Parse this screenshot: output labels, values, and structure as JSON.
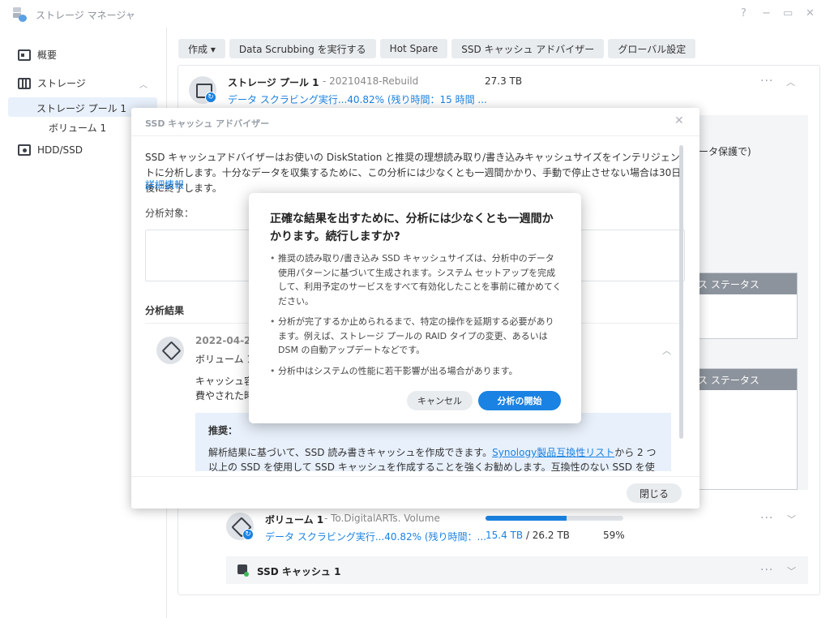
{
  "window": {
    "title": "ストレージ マネージャ",
    "controls": [
      "?",
      "−",
      "▭",
      "✕"
    ]
  },
  "sidebar": {
    "items": [
      {
        "label": "概要",
        "icon": "overview-icon"
      },
      {
        "label": "ストレージ",
        "icon": "storage-icon"
      },
      {
        "label": "HDD/SSD",
        "icon": "hdd-icon"
      }
    ],
    "sub_item": "ストレージ プール 1",
    "sub_sub_item": "ボリューム 1"
  },
  "toolbar": {
    "buttons": [
      "作成 ▾",
      "Data Scrubbing を実行する",
      "Hot Spare",
      "SSD キャッシュ アドバイザー",
      "グローバル設定"
    ]
  },
  "pool": {
    "title": "ストレージ プール 1",
    "subtitle": "- 20210418-Rebuild",
    "size": "27.3 TB",
    "scrub_status": "データ スクラビング実行...40.82% (残り時間：15 時間 ..."
  },
  "background_fragments": {
    "right_text": "ータ保護で)",
    "status_header_1": "ス ステータス",
    "status_header_2": "ス ステータス"
  },
  "volume": {
    "title": "ボリューム 1",
    "subtitle": "- To.DigitalARTs. Volume",
    "scrub_status": "データ スクラビング実行...40.82% (残り時間：...",
    "used": "15.4 TB",
    "total": "/ 26.2 TB",
    "percent": "59%",
    "usage_fraction": 0.59
  },
  "cache": {
    "title": "SSD キャッシュ 1"
  },
  "advisor": {
    "title": "SSD キャッシュ アドバイザー",
    "description": "SSD キャッシュアドバイザーはお使いの DiskStation と推奨の理想読み取り/書き込みキャッシュサイズをインテリジェントに分析します。十分なデータを収集するために、この分析には少なくとも一週間かかり、手動で停止させない場合は30日後に終了します。",
    "details_link": "詳細情報",
    "target_label": "分析対象：",
    "results_label": "分析結果",
    "result": {
      "date": "2022-04-2",
      "volume": "ボリューム 1",
      "text_line1": "キャッシュ容",
      "text_line2": "費やされた時"
    },
    "recommendation": {
      "title": "推奨：",
      "body_pre": "解析結果に基づいて、SSD 読み書きキャッシュを作成できます。",
      "link": "Synology製品互換性リスト",
      "body_post": "から 2 つ以上の SSD を使用して SSD キャッシュを作成することを強くお勧めします。互換性のない SSD を使用すると、システムのパフォーマンスが低下し、データの損失につながる可能性があります。"
    },
    "close_button": "閉じる"
  },
  "confirm": {
    "title": "正確な結果を出すために、分析には少なくとも一週間かかります。続行しますか?",
    "bullets": [
      "推奨の読み取り/書き込み SSD キャッシュサイズは、分析中のデータ使用パターンに基づいて生成されます。システム セットアップを完成して、利用予定のサービスをすべて有効化したことを事前に確かめてください。",
      "分析が完了するか止められるまで、特定の操作を延期する必要があります。例えば、ストレージ プールの RAID タイプの変更、あるいは DSM の自動アップデートなどです。",
      "分析中はシステムの性能に若干影響が出る場合があります。"
    ],
    "cancel_button": "キャンセル",
    "start_button": "分析の開始"
  }
}
